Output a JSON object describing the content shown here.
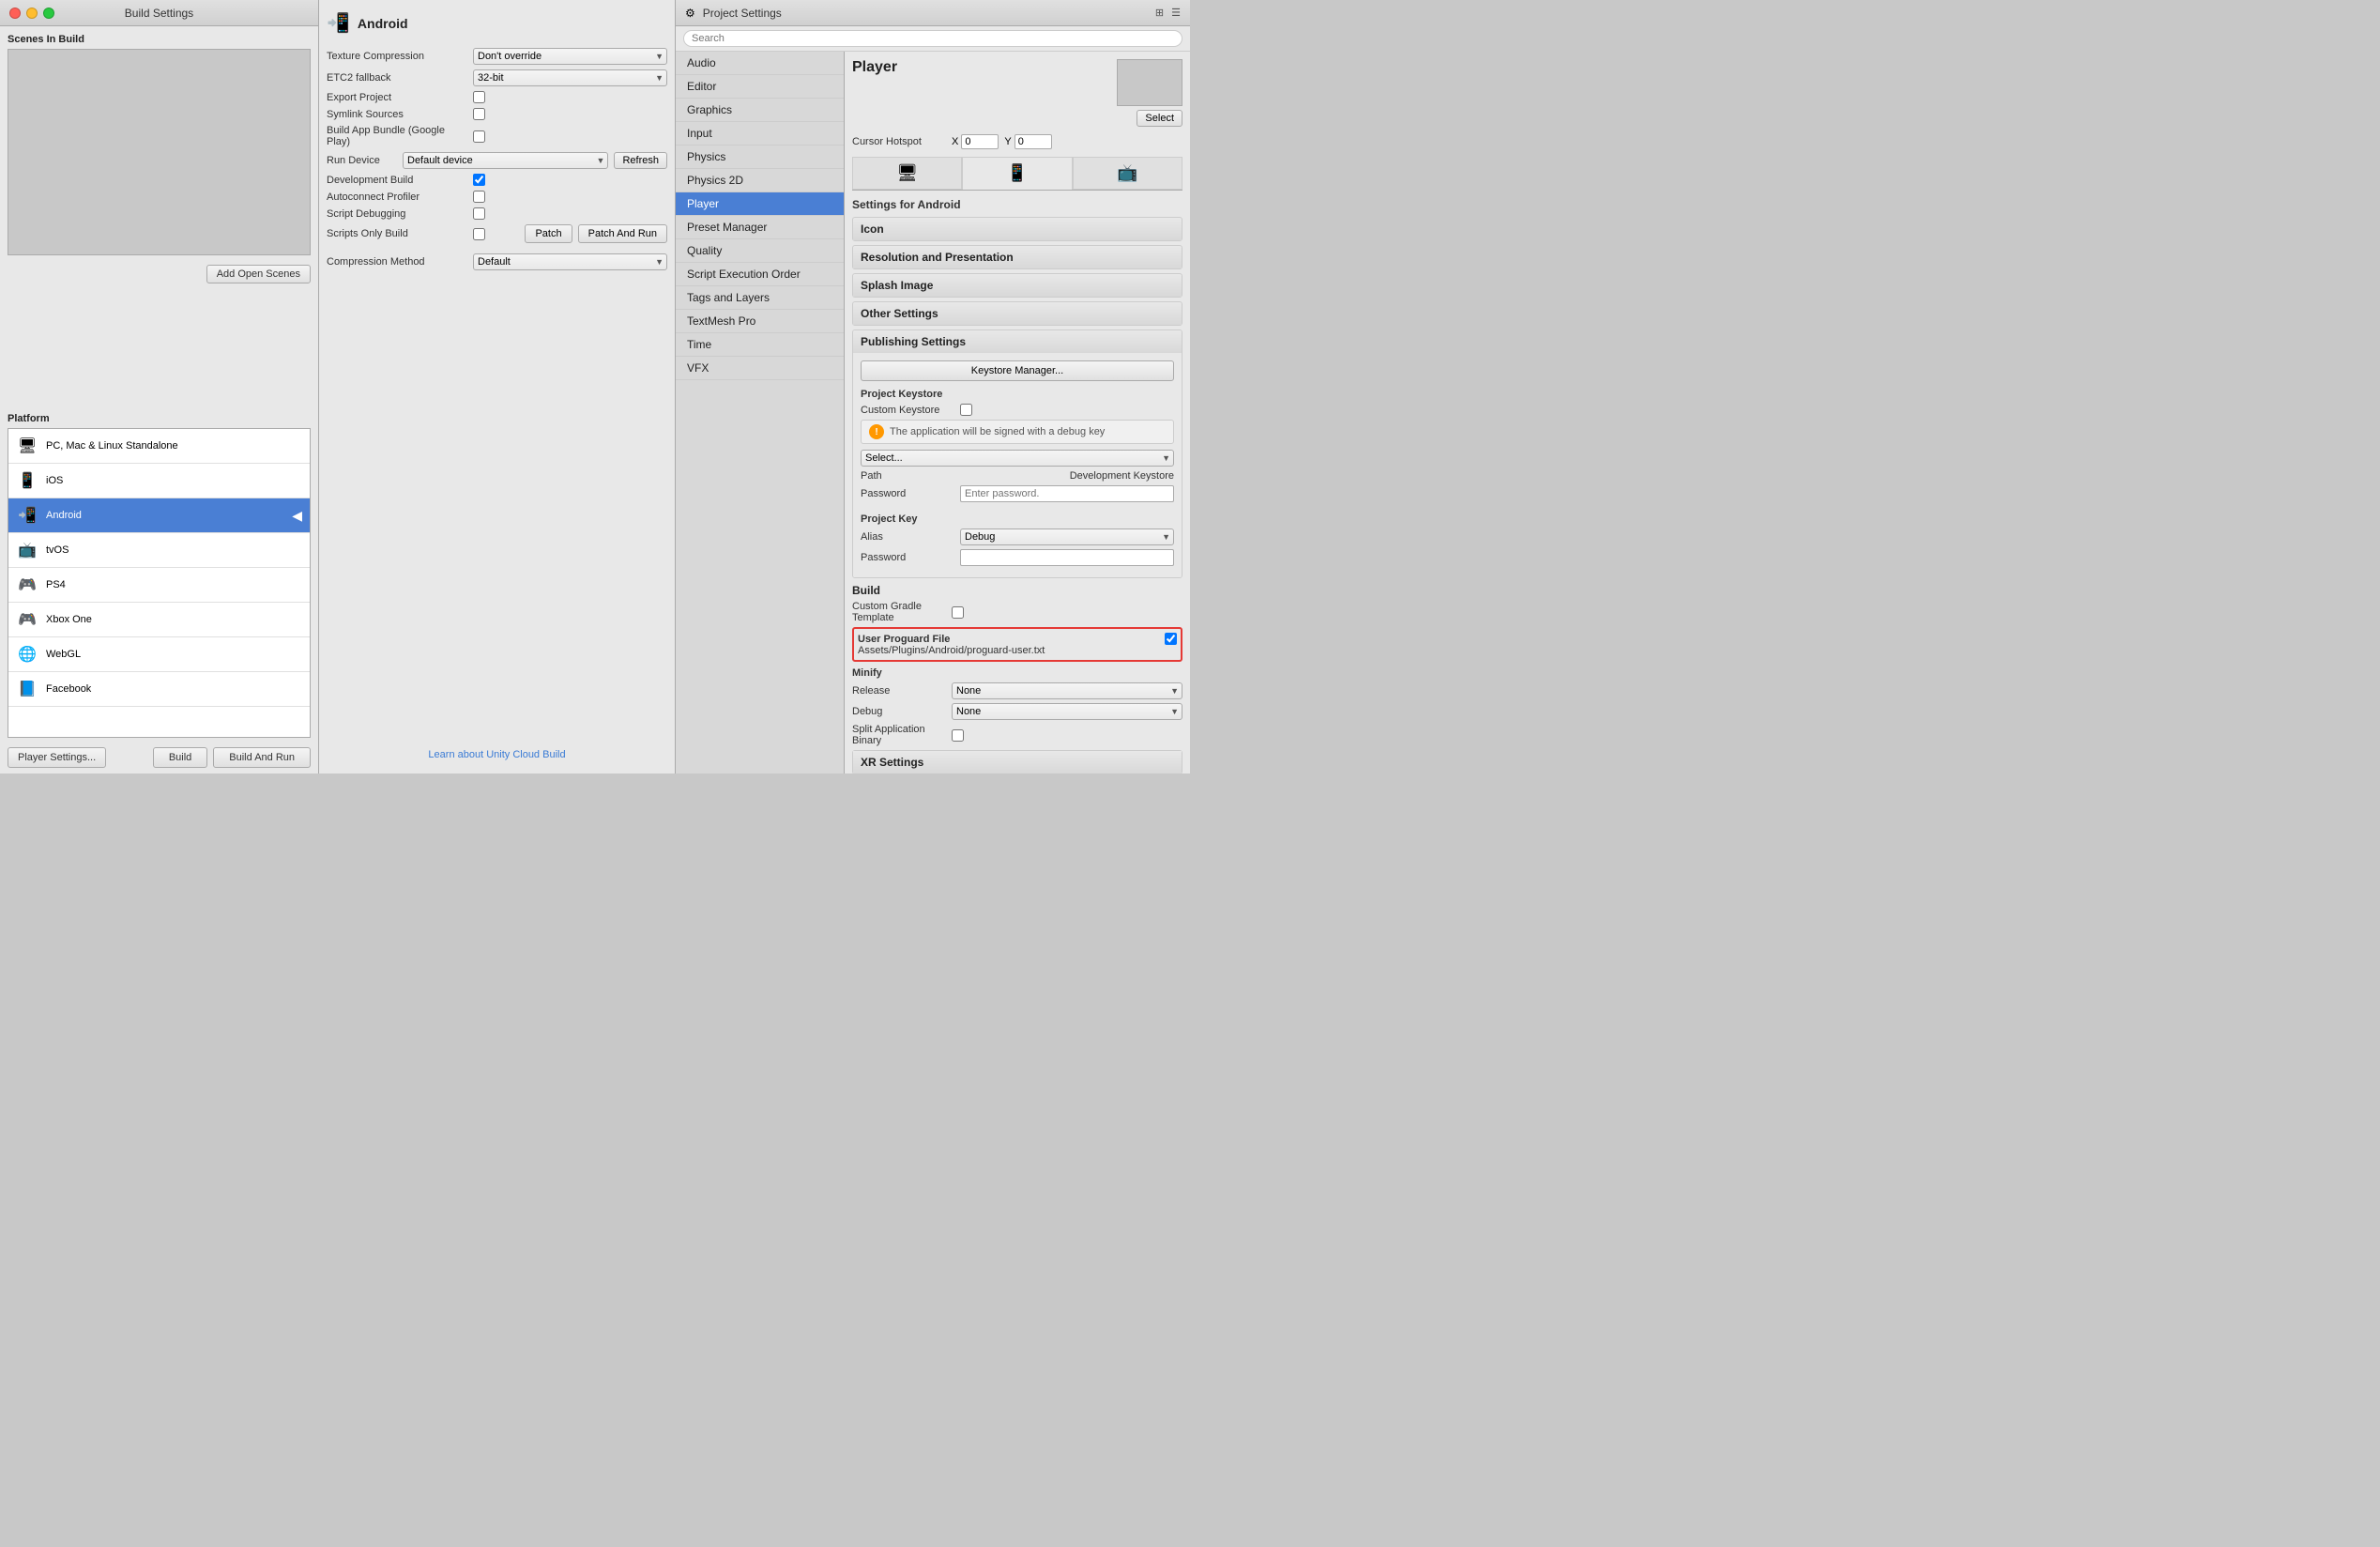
{
  "buildSettings": {
    "title": "Build Settings",
    "scenesSection": {
      "header": "Scenes In Build"
    },
    "addOpenScenesButton": "Add Open Scenes",
    "platformSection": {
      "header": "Platform"
    },
    "platforms": [
      {
        "id": "pc",
        "label": "PC, Mac & Linux Standalone",
        "icon": "🖥",
        "selected": false
      },
      {
        "id": "ios",
        "label": "iOS",
        "icon": "📱",
        "selected": false
      },
      {
        "id": "android",
        "label": "Android",
        "icon": "📲",
        "selected": true
      },
      {
        "id": "tvos",
        "label": "tvOS",
        "icon": "📺",
        "selected": false
      },
      {
        "id": "ps4",
        "label": "PS4",
        "icon": "🎮",
        "selected": false
      },
      {
        "id": "xboxone",
        "label": "Xbox One",
        "icon": "🎮",
        "selected": false
      },
      {
        "id": "webgl",
        "label": "WebGL",
        "icon": "🌐",
        "selected": false
      },
      {
        "id": "facebook",
        "label": "Facebook",
        "icon": "📘",
        "selected": false
      }
    ],
    "playerSettingsButton": "Player Settings...",
    "buildButton": "Build",
    "buildAndRunButton": "Build And Run"
  },
  "androidSettings": {
    "platformName": "Android",
    "textureCompression": {
      "label": "Texture Compression",
      "value": "Don't override"
    },
    "etc2Fallback": {
      "label": "ETC2 fallback",
      "value": "32-bit"
    },
    "exportProject": {
      "label": "Export Project",
      "checked": false
    },
    "symlinkSources": {
      "label": "Symlink Sources",
      "checked": false
    },
    "buildAppBundle": {
      "label": "Build App Bundle (Google Play)",
      "checked": false
    },
    "runDevice": {
      "label": "Run Device",
      "value": "Default device",
      "refreshButton": "Refresh"
    },
    "developmentBuild": {
      "label": "Development Build",
      "checked": true
    },
    "autoconnectProfiler": {
      "label": "Autoconnect Profiler",
      "checked": false
    },
    "scriptDebugging": {
      "label": "Script Debugging",
      "checked": false
    },
    "scriptsOnlyBuild": {
      "label": "Scripts Only Build",
      "checked": false
    },
    "patchButton": "Patch",
    "patchAndRunButton": "Patch And Run",
    "compressionMethod": {
      "label": "Compression Method",
      "value": "Default"
    },
    "cloudBuildLink": "Learn about Unity Cloud Build"
  },
  "projectSettings": {
    "title": "Project Settings",
    "searchPlaceholder": "Search",
    "sidebar": {
      "items": [
        {
          "id": "audio",
          "label": "Audio"
        },
        {
          "id": "editor",
          "label": "Editor"
        },
        {
          "id": "graphics",
          "label": "Graphics"
        },
        {
          "id": "input",
          "label": "Input"
        },
        {
          "id": "physics",
          "label": "Physics"
        },
        {
          "id": "physics2d",
          "label": "Physics 2D"
        },
        {
          "id": "player",
          "label": "Player",
          "active": true
        },
        {
          "id": "presetmanager",
          "label": "Preset Manager"
        },
        {
          "id": "quality",
          "label": "Quality"
        },
        {
          "id": "scriptexecutionorder",
          "label": "Script Execution Order"
        },
        {
          "id": "tagsandlayers",
          "label": "Tags and Layers"
        },
        {
          "id": "textmeshpro",
          "label": "TextMesh Pro"
        },
        {
          "id": "time",
          "label": "Time"
        },
        {
          "id": "vfx",
          "label": "VFX"
        }
      ]
    },
    "player": {
      "title": "Player",
      "selectButton": "Select",
      "cursorHotspot": {
        "label": "Cursor Hotspot",
        "xLabel": "X",
        "xValue": "0",
        "yLabel": "Y",
        "yValue": "0"
      },
      "settingsFor": "Settings for Android",
      "tabs": [
        {
          "id": "desktop",
          "icon": "🖥"
        },
        {
          "id": "tablet",
          "icon": "📱"
        },
        {
          "id": "tv",
          "icon": "📺"
        }
      ],
      "sections": {
        "icon": "Icon",
        "resolutionAndPresentation": "Resolution and Presentation",
        "splashImage": "Splash Image",
        "otherSettings": "Other Settings"
      },
      "publishingSettings": {
        "header": "Publishing Settings",
        "keystoreManagerButton": "Keystore Manager...",
        "projectKeystore": {
          "header": "Project Keystore",
          "customKeystoreLabel": "Custom Keystore",
          "customKeystoreChecked": false,
          "debugKeyInfo": "The application will be signed with a debug key",
          "selectPlaceholder": "Select...",
          "pathLabel": "Path",
          "developmentKeystoreLabel": "Development Keystore",
          "passwordLabel": "Password",
          "passwordPlaceholder": "Enter password."
        },
        "projectKey": {
          "header": "Project Key",
          "aliasLabel": "Alias",
          "aliasValue": "Debug",
          "passwordLabel": "Password",
          "passwordValue": ""
        }
      },
      "build": {
        "header": "Build",
        "customGradleTemplate": {
          "label": "Custom Gradle Template",
          "checked": false
        },
        "userProguardFile": {
          "label": "User Proguard File",
          "checked": true,
          "path": "Assets/Plugins/Android/proguard-user.txt"
        },
        "minify": {
          "header": "Minify",
          "release": {
            "label": "Release",
            "value": "None"
          },
          "debug": {
            "label": "Debug",
            "value": "None"
          }
        },
        "splitApplicationBinary": {
          "label": "Split Application Binary",
          "checked": false
        }
      },
      "xrSettings": {
        "header": "XR Settings"
      }
    }
  }
}
